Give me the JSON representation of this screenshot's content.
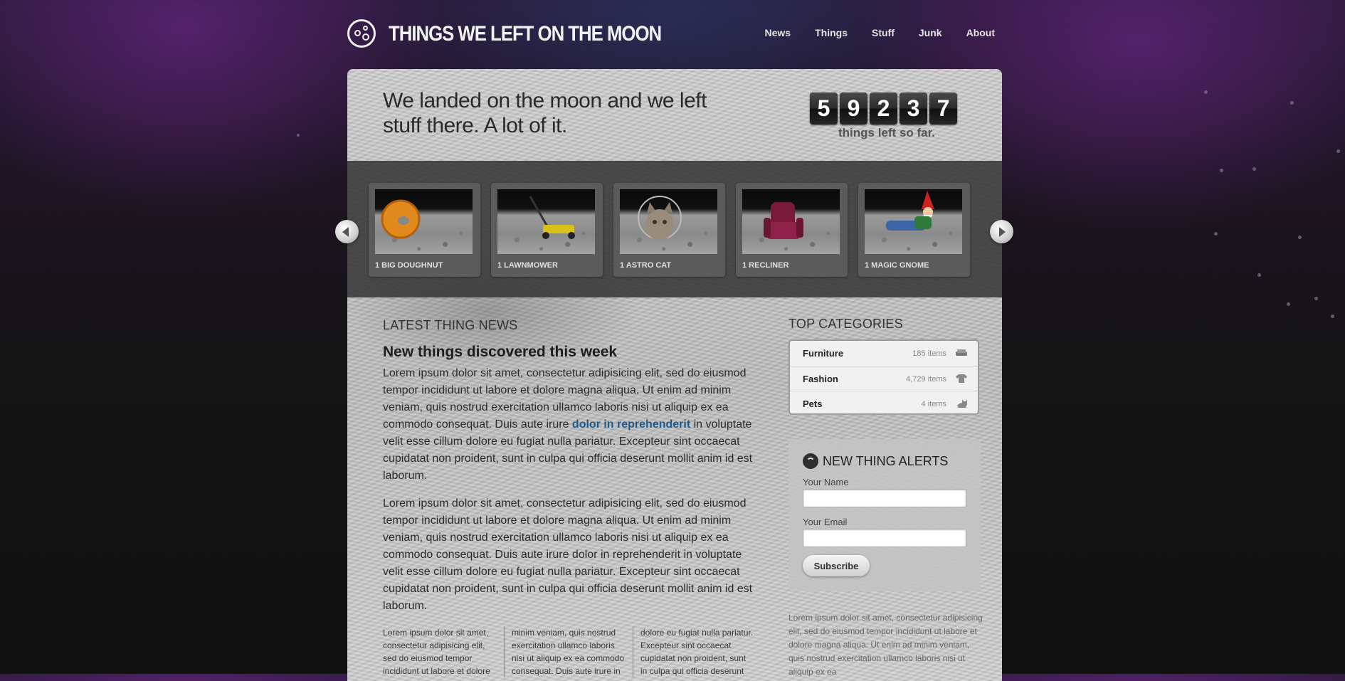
{
  "site": {
    "title": "THINGS WE LEFT ON THE MOON"
  },
  "nav": [
    {
      "label": "News"
    },
    {
      "label": "Things"
    },
    {
      "label": "Stuff"
    },
    {
      "label": "Junk"
    },
    {
      "label": "About"
    }
  ],
  "hero": {
    "tagline": "We landed on the moon and we left stuff there. A lot of it.",
    "counter_digits": [
      "5",
      "9",
      "2",
      "3",
      "7"
    ],
    "counter_caption": "things left so far."
  },
  "carousel": {
    "items": [
      {
        "label": "1 BIG DOUGHNUT",
        "icon": "doughnut-image"
      },
      {
        "label": "1 LAWNMOWER",
        "icon": "lawnmower-image"
      },
      {
        "label": "1 ASTRO CAT",
        "icon": "astro-cat-image"
      },
      {
        "label": "1 RECLINER",
        "icon": "recliner-image"
      },
      {
        "label": "1 MAGIC GNOME",
        "icon": "gnome-image"
      }
    ]
  },
  "news": {
    "section_title": "LATEST THING NEWS",
    "article_title": "New things discovered this week",
    "para1_before": "Lorem ipsum dolor sit amet, consectetur adipisicing elit, sed do eiusmod tempor incididunt ut labore et dolore magna aliqua. Ut enim ad minim veniam, quis nostrud exercitation ullamco laboris nisi ut aliquip ex ea commodo consequat. Duis aute irure ",
    "para1_link": "dolor in reprehenderit",
    "para1_after": " in voluptate velit esse cillum dolore eu fugiat nulla pariatur. Excepteur sint occaecat cupidatat non proident, sunt in culpa qui officia deserunt mollit anim id est laborum.",
    "para2": "Lorem ipsum dolor sit amet, consectetur adipisicing elit, sed do eiusmod tempor incididunt ut labore et dolore magna aliqua. Ut enim ad minim veniam, quis nostrud exercitation ullamco laboris nisi ut aliquip ex ea commodo consequat. Duis aute irure dolor in reprehenderit in voluptate velit esse cillum dolore eu fugiat nulla pariatur. Excepteur sint occaecat cupidatat non proident, sunt in culpa qui officia deserunt mollit anim id est laborum.",
    "columns": [
      "Lorem ipsum dolor sit amet, consectetur adipisicing elit, sed do eiusmod tempor incididunt ut labore et dolore",
      "minim veniam, quis nostrud exercitation ullamco laboris nisi ut aliquip ex ea commodo consequat. Duis aute irure in",
      "dolore eu fugiat nulla pariatur. Excepteur sint occaecat cupidatat non proident, sunt in culpa qui officia deserunt"
    ]
  },
  "categories": {
    "title": "TOP CATEGORIES",
    "items": [
      {
        "name": "Furniture",
        "count": "185 items",
        "icon": "sofa-icon"
      },
      {
        "name": "Fashion",
        "count": "4,729 items",
        "icon": "tshirt-icon"
      },
      {
        "name": "Pets",
        "count": "4 items",
        "icon": "cat-icon"
      }
    ]
  },
  "alerts": {
    "title": "NEW THING ALERTS",
    "name_label": "Your Name",
    "email_label": "Your Email",
    "name_value": "",
    "email_value": "",
    "subscribe_label": "Subscribe"
  },
  "sidebar_text": "Lorem ipsum dolor sit amet, consectetur adipisicing elit, sed do eiusmod tempor incididunt ut labore et dolore magna aliqua. Ut enim ad minim veniam, quis nostrud exercitation ullamco laboris nisi ut aliquip ex ea",
  "colors": {
    "link": "#1f5a8c",
    "counter_bg": "#2c2c2c"
  }
}
